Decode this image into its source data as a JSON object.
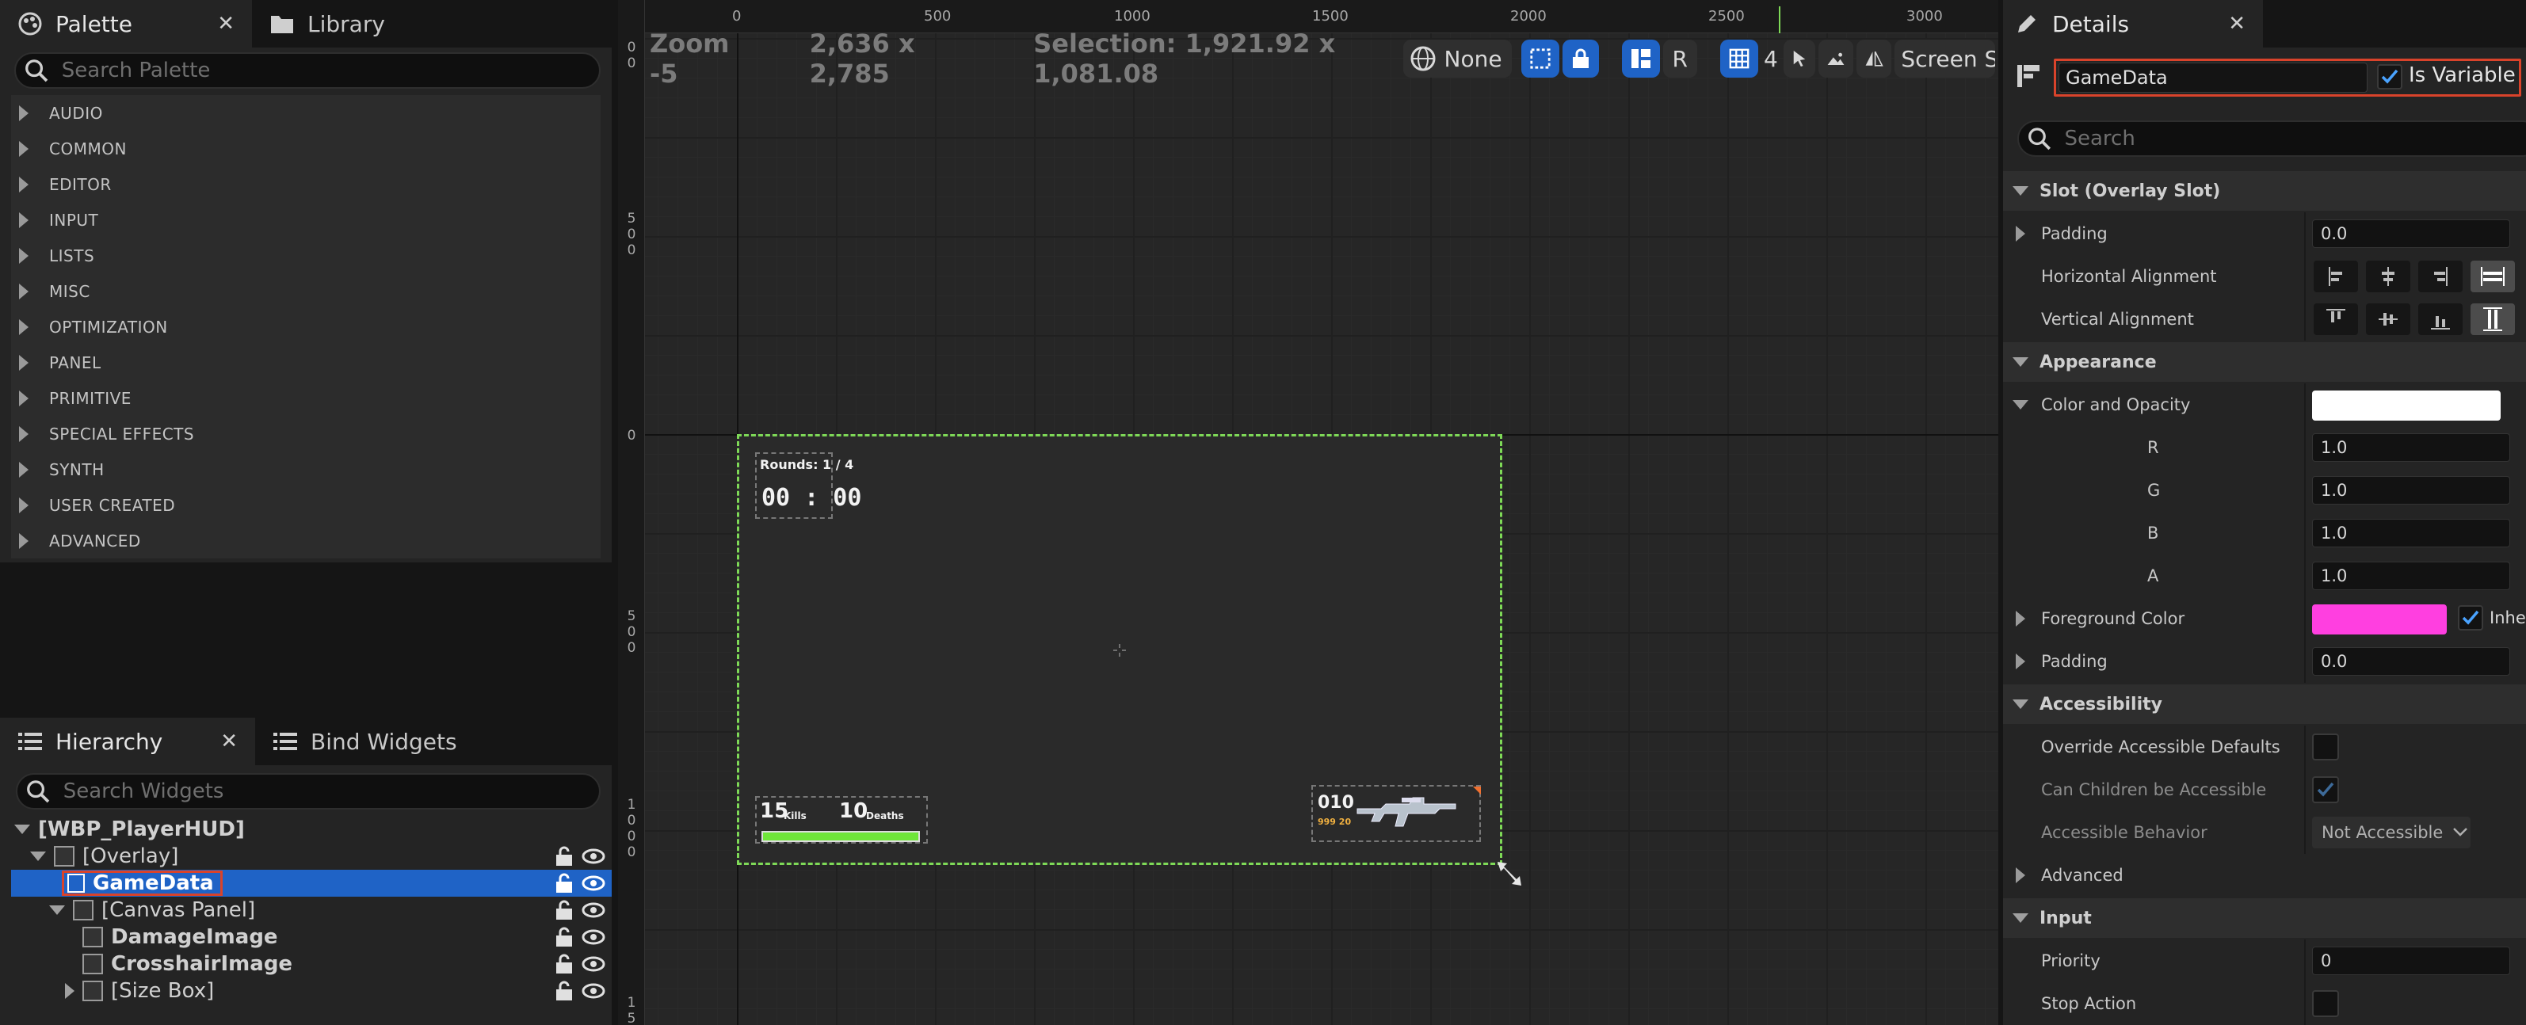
{
  "palette": {
    "tab_label": "Palette",
    "library_tab_label": "Library",
    "close_glyph": "✕",
    "search_placeholder": "Search Palette",
    "categories": [
      "AUDIO",
      "COMMON",
      "EDITOR",
      "INPUT",
      "LISTS",
      "MISC",
      "OPTIMIZATION",
      "PANEL",
      "PRIMITIVE",
      "SPECIAL EFFECTS",
      "SYNTH",
      "USER CREATED",
      "ADVANCED"
    ]
  },
  "hierarchy": {
    "tab_label": "Hierarchy",
    "bind_widgets_tab_label": "Bind Widgets",
    "close_glyph": "✕",
    "search_placeholder": "Search Widgets",
    "items": [
      {
        "label": "[WBP_PlayerHUD]"
      },
      {
        "label": "[Overlay]"
      },
      {
        "label": "GameData",
        "selected": true
      },
      {
        "label": "[Canvas Panel]"
      },
      {
        "label": "DamageImage"
      },
      {
        "label": "CrosshairImage"
      },
      {
        "label": "[Size Box]"
      }
    ]
  },
  "viewport": {
    "zoom": "Zoom -5",
    "canvas_size": "2,636 x 2,785",
    "selection": "Selection: 1,921.92 x 1,081.08",
    "ruler_top": [
      "0",
      "500",
      "1000",
      "1500",
      "2000",
      "2500",
      "3000"
    ],
    "ruler_left": [
      [
        "0",
        "0"
      ],
      [
        "5",
        "0",
        "0"
      ],
      [
        "0"
      ],
      [
        "5",
        "0",
        "0"
      ],
      [
        "1",
        "0",
        "0",
        "0"
      ],
      [
        "1",
        "5"
      ]
    ],
    "toolbar": {
      "none_label": "None",
      "r_label": "R",
      "grid_count": "4",
      "screen_size_label": "Screen Size"
    },
    "hud": {
      "rounds": "Rounds: 1 / 4",
      "timer": "00 : 00",
      "kills_value": "15",
      "kills_label": "Kills",
      "deaths_value": "10",
      "deaths_label": "Deaths",
      "ammo": "010",
      "ammo_reserve": "999 20"
    },
    "colors": {
      "selection_outline": "#7ed957",
      "health_bar": "#6fe63a"
    }
  },
  "details": {
    "tab_label": "Details",
    "close_glyph": "✕",
    "name_value": "GameData",
    "is_variable_label": "Is Variable",
    "is_variable_checked": true,
    "search_placeholder": "Search",
    "sections": {
      "slot": "Slot (Overlay Slot)",
      "appearance": "Appearance",
      "accessibility": "Accessibility",
      "input": "Input"
    },
    "props": {
      "padding_label": "Padding",
      "padding_value": "0.0",
      "halign_label": "Horizontal Alignment",
      "valign_label": "Vertical Alignment",
      "color_opacity_label": "Color and Opacity",
      "r_label": "R",
      "r_value": "1.0",
      "g_label": "G",
      "g_value": "1.0",
      "b_label": "B",
      "b_value": "1.0",
      "a_label": "A",
      "a_value": "1.0",
      "foreground_label": "Foreground Color",
      "inherit_label": "Inherit",
      "padding2_label": "Padding",
      "padding2_value": "0.0",
      "override_label": "Override Accessible Defaults",
      "can_children_label": "Can Children be Accessible",
      "behavior_label": "Accessible Behavior",
      "behavior_value": "Not Accessible",
      "advanced_label": "Advanced",
      "priority_label": "Priority",
      "priority_value": "0",
      "stop_action_label": "Stop Action"
    },
    "colors": {
      "color_opacity_swatch": "#ffffff",
      "foreground_swatch": "#ff3fe0",
      "name_highlight": "#d9432b",
      "selection_blue": "#1f63c6"
    }
  }
}
